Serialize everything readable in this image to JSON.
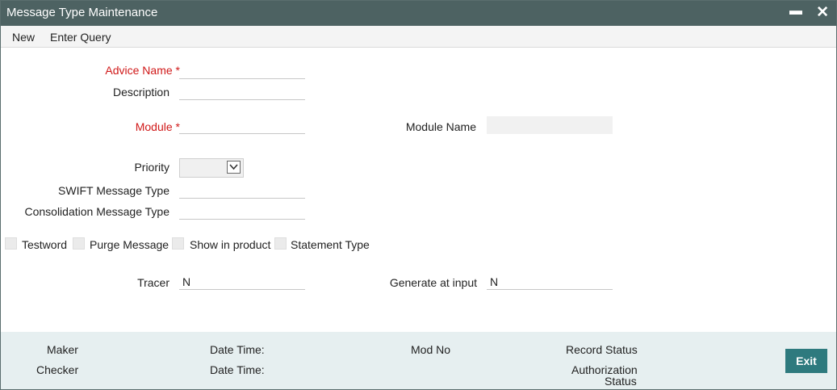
{
  "window": {
    "title": "Message Type Maintenance",
    "minimize_icon": "minimize-icon",
    "close_icon": "close-icon"
  },
  "menu": {
    "new_label": "New",
    "enter_query_label": "Enter Query"
  },
  "form": {
    "advice_name_label": "Advice Name",
    "description_label": "Description",
    "module_label": "Module",
    "module_name_label": "Module Name",
    "priority_label": "Priority",
    "swift_message_type_label": "SWIFT Message Type",
    "consolidation_message_type_label": "Consolidation Message Type",
    "required_marker": "*",
    "checkboxes": {
      "testword": "Testword",
      "purge_message": "Purge Message",
      "show_in_product": "Show in product",
      "statement_type": "Statement Type"
    },
    "tracer_label": "Tracer",
    "tracer_value": "N",
    "generate_at_input_label": "Generate at input",
    "generate_at_input_value": "N"
  },
  "footer": {
    "maker_label": "Maker",
    "checker_label": "Checker",
    "date_time_label": "Date Time:",
    "mod_no_label": "Mod No",
    "record_status_label": "Record Status",
    "authorization_label": "Authorization",
    "status_label": "Status",
    "exit_label": "Exit"
  },
  "colors": {
    "title_bar": "#4d6262",
    "required": "#d01818",
    "footer_bg": "#e6eff0",
    "exit_button": "#2e7a7e"
  }
}
